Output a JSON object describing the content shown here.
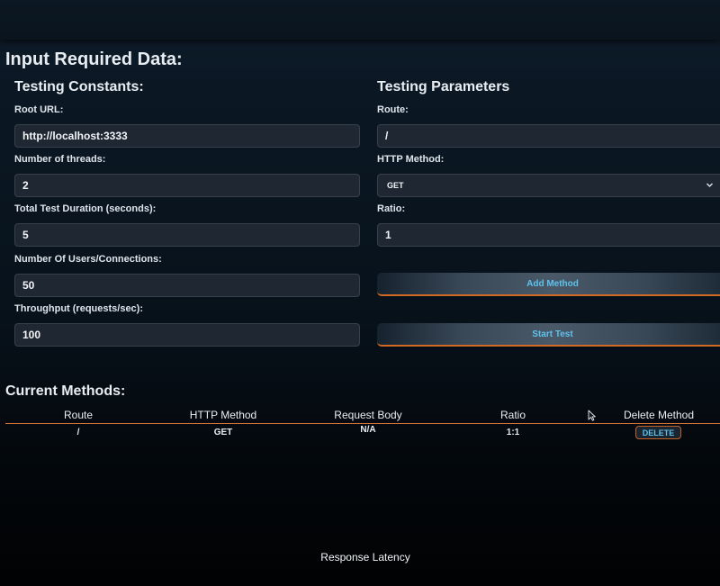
{
  "page": {
    "heading": "Input Required Data:"
  },
  "constants": {
    "title": "Testing Constants:",
    "root_url": {
      "label": "Root URL:",
      "value": "http://localhost:3333"
    },
    "threads": {
      "label": "Number of threads:",
      "value": "2"
    },
    "duration": {
      "label": "Total Test Duration (seconds):",
      "value": "5"
    },
    "users": {
      "label": "Number Of Users/Connections:",
      "value": "50"
    },
    "throughput": {
      "label": "Throughput (requests/sec):",
      "value": "100"
    }
  },
  "parameters": {
    "title": "Testing Parameters",
    "route": {
      "label": "Route:",
      "value": "/"
    },
    "http_method": {
      "label": "HTTP Method:",
      "selected": "GET"
    },
    "ratio": {
      "label": "Ratio:",
      "value": "1"
    },
    "add_method_label": "Add Method",
    "start_test_label": "Start Test"
  },
  "methods": {
    "title": "Current Methods:",
    "columns": [
      "Route",
      "HTTP Method",
      "Request Body",
      "Ratio",
      "Delete Method"
    ],
    "rows": [
      {
        "route": "/",
        "http_method": "GET",
        "request_body": "N/A",
        "ratio": "1:1",
        "delete_label": "DELETE"
      }
    ]
  },
  "chart": {
    "title": "Response Latency"
  },
  "icons": {
    "select_chevron": "chevron-down-icon",
    "pointer": "mouse-cursor-icon"
  },
  "colors": {
    "accent_orange": "#d26a25",
    "accent_blue": "#5ec2ec",
    "input_bg": "#1f2832",
    "page_bg": "#07111a"
  }
}
